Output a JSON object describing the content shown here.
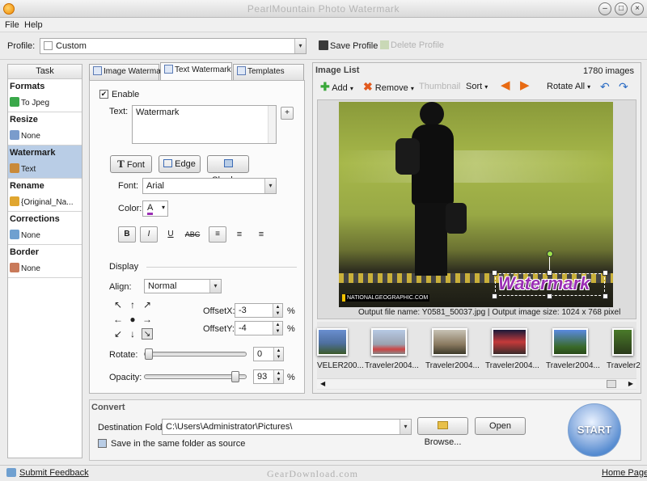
{
  "window": {
    "title": "PearlMountain Photo Watermark"
  },
  "menu": {
    "file": "File",
    "help": "Help"
  },
  "profile": {
    "label": "Profile:",
    "value": "Custom",
    "save": "Save Profile",
    "delete": "Delete Profile"
  },
  "task": {
    "header": "Task",
    "groups": [
      {
        "title": "Formats",
        "value": "To Jpeg"
      },
      {
        "title": "Resize",
        "value": "None"
      },
      {
        "title": "Watermark",
        "value": "Text"
      },
      {
        "title": "Rename",
        "value": "{Original_Na..."
      },
      {
        "title": "Corrections",
        "value": "None"
      },
      {
        "title": "Border",
        "value": "None"
      }
    ]
  },
  "tabs": {
    "image": "Image Watermark",
    "text": "Text Watermark",
    "templates": "Templates"
  },
  "text_watermark": {
    "enable": "Enable",
    "text_label": "Text:",
    "text_value": "Watermark",
    "plus": "+",
    "font_btn": "Font",
    "edge_btn": "Edge",
    "shadow_btn": "Shadow",
    "font_label": "Font:",
    "font_value": "Arial",
    "color_label": "Color:",
    "color_value": "A",
    "style_bold": "B",
    "style_italic": "I",
    "style_underline": "U",
    "style_strike": "ABC",
    "display_label": "Display",
    "align_label": "Align:",
    "align_value": "Normal",
    "offsetx_label": "OffsetX:",
    "offsetx_value": "-3",
    "offsety_label": "OffsetY:",
    "offsety_value": "-4",
    "percent": "%",
    "rotate_label": "Rotate:",
    "rotate_value": "0",
    "opacity_label": "Opacity:",
    "opacity_value": "93",
    "rotate_level": 0,
    "opacity_level": 0.93
  },
  "image_list": {
    "title": "Image List",
    "count": "1780 images",
    "add": "Add",
    "remove": "Remove",
    "thumbnail": "Thumbnail",
    "sort": "Sort",
    "rotate_all": "Rotate All",
    "preview_watermark": "Watermark",
    "preview_badge": "NATIONALGEOGRAPHIC.COM",
    "output_info": "Output file name: Y0581_50037.jpg | Output image size: 1024 x 768 pixel",
    "thumbs": [
      "VELER200...",
      "Traveler2004...",
      "Traveler2004...",
      "Traveler2004...",
      "Traveler2004...",
      "Traveler2"
    ]
  },
  "convert": {
    "title": "Convert",
    "dest_label": "Destination Folder:",
    "dest_value": "C:\\Users\\Administrator\\Pictures\\",
    "browse": "Browse...",
    "open": "Open",
    "same_folder": "Save in the same folder as source",
    "start": "START"
  },
  "status": {
    "feedback": "Submit Feedback",
    "watermark": "GearDownload.com",
    "home": "Home Page"
  },
  "colors": {
    "accent": "#1a64c8",
    "selection": "#b9cde6",
    "watermark_text": "#9b2fb5",
    "start": "#2a6fc4"
  }
}
